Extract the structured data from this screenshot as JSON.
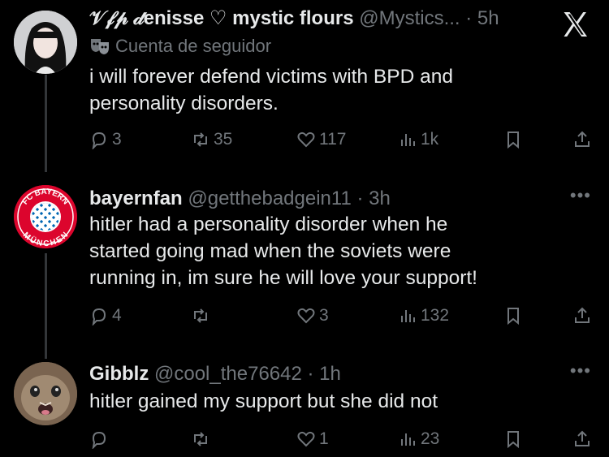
{
  "tweets": [
    {
      "display_name": "𝒱𝒻𝓅 𝒹enisse ♡ mystic flours",
      "handle": "@Mystics...",
      "time": "· 5h",
      "badge": "Cuenta de seguidor",
      "text_lines": [
        "i will forever defend victims with BPD and",
        "personality disorders."
      ],
      "replies": "3",
      "reposts": "35",
      "likes": "117",
      "views": "1k"
    },
    {
      "display_name": "bayernfan",
      "handle": "@getthebadgein11",
      "time": "· 3h",
      "text_lines": [
        "hitler had a personality disorder when he",
        "started going mad when the soviets were",
        "running in, im sure he will love your support!"
      ],
      "replies": "4",
      "reposts": "",
      "likes": "3",
      "views": "132"
    },
    {
      "display_name": "Gibblz",
      "handle": "@cool_the76642",
      "time": "· 1h",
      "text_lines": [
        "hitler gained my support but she did not"
      ],
      "replies": "",
      "reposts": "",
      "likes": "1",
      "views": "23"
    }
  ],
  "avatar_texts": {
    "bayern_top": "FC BAYERN",
    "bayern_bottom": "MÜNCHEN"
  },
  "more_menu": "•••",
  "colors": {
    "background": "#000000",
    "text": "#e7e9ea",
    "muted": "#71767b",
    "divider": "#333639"
  }
}
